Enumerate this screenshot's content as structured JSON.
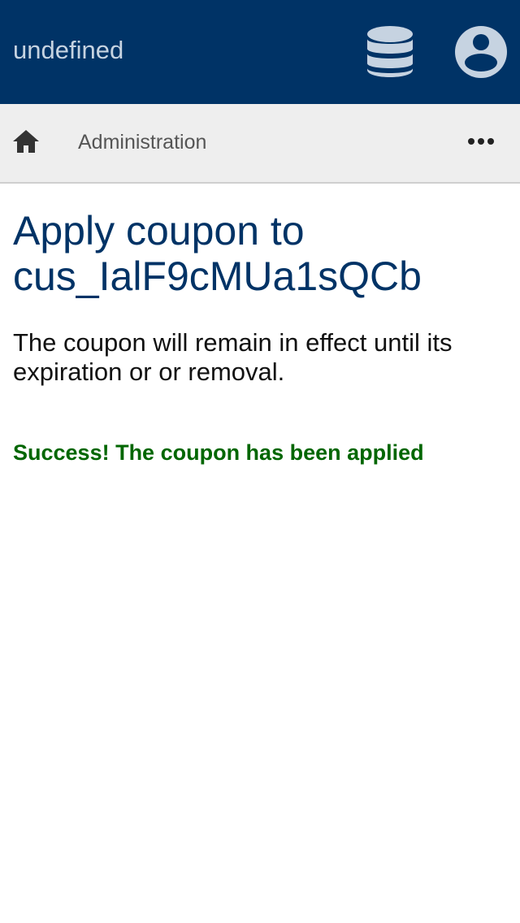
{
  "app_bar": {
    "title": "undefined",
    "database_button": {
      "icon": "database-icon",
      "color": "#c6d3e1"
    },
    "account_button": {
      "icon": "account-circle-icon",
      "color": "#c6d3e1"
    },
    "background": "#003366"
  },
  "breadcrumb": {
    "home_icon": "home-icon",
    "items": [
      {
        "label": "Administration"
      }
    ],
    "more_icon": "more-horizontal-icon"
  },
  "main": {
    "title": "Apply coupon to cus_IalF9cMUa1sQCb",
    "description": "The coupon will remain in effect until its expiration or or removal.",
    "success_message": "Success! The coupon has been applied",
    "title_color": "#003366",
    "success_color": "#006600"
  }
}
